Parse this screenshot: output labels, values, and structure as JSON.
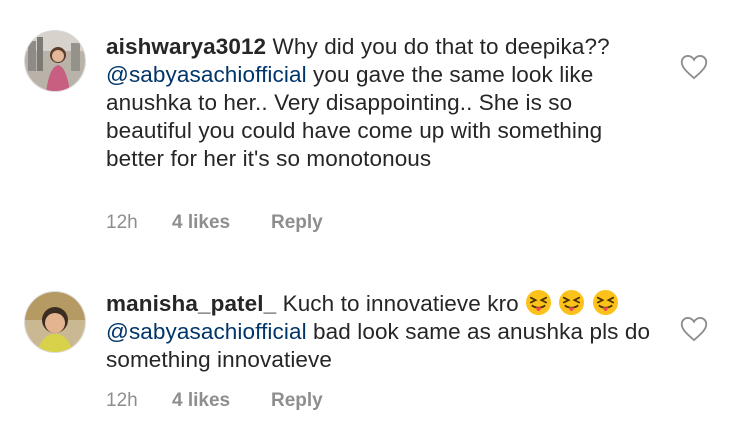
{
  "comments": [
    {
      "username": "aishwarya3012",
      "text_before": " Why did you do that to deepika?? ",
      "mention": "@sabyasachiofficial",
      "text_after": " you gave the same look like anushka to her.. Very disappointing.. She is so beautiful you could have come up with something better for her it's so monotonous",
      "time": "12h",
      "likes": "4 likes",
      "reply": "Reply"
    },
    {
      "username": "manisha_patel_",
      "text_before": " Kuch to innovatieve kro ",
      "mention": "@sabyasachiofficial",
      "text_after": " bad look same as anushka pls do something innovatieve",
      "emojis": [
        "squinting-tongue-face",
        "squinting-tongue-face",
        "squinting-tongue-face"
      ],
      "time": "12h",
      "likes": "4 likes",
      "reply": "Reply"
    }
  ],
  "colors": {
    "mention": "#003569",
    "meta": "#8e8e8e",
    "text": "#262626"
  }
}
